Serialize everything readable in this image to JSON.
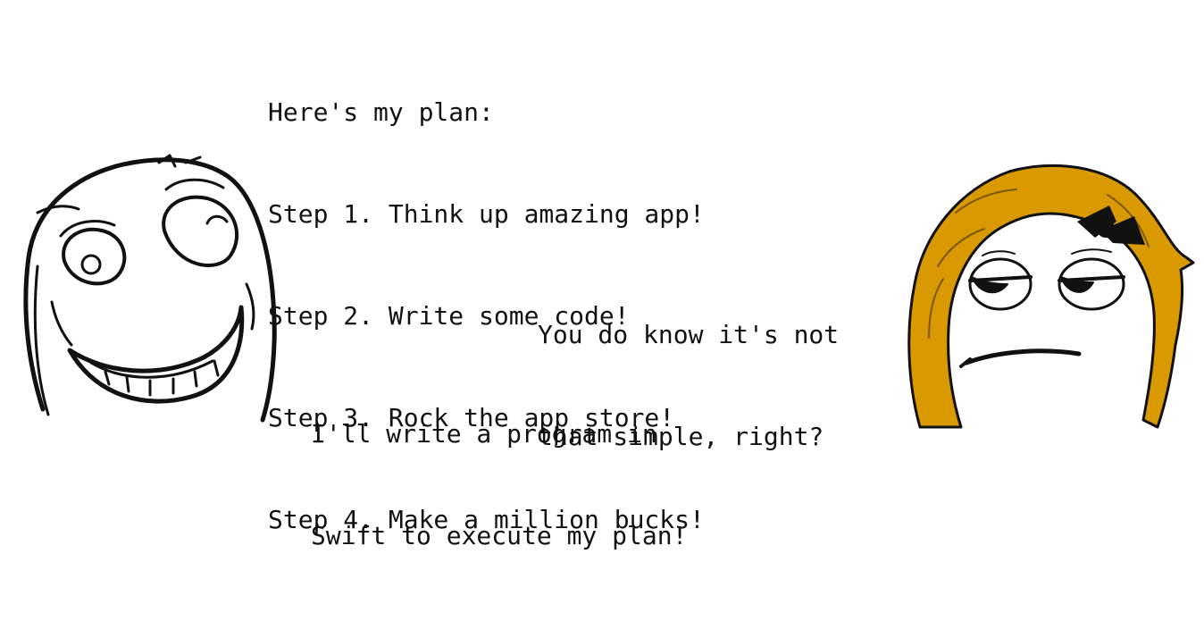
{
  "plan": {
    "heading": "Here's my plan:",
    "steps": [
      "Step 1. Think up amazing app!",
      "Step 2. Write some code!",
      "Step 3. Rock the app store!",
      "Step 4. Make a million bucks!"
    ]
  },
  "reply": {
    "lines": [
      "You do know it's not",
      "that simple, right?"
    ]
  },
  "program": {
    "lines": [
      "I'll write a program in",
      "Swift to execute my plan!"
    ]
  },
  "colors": {
    "hair": "#d89a00",
    "ink": "#111111",
    "background": "#ffffff"
  }
}
